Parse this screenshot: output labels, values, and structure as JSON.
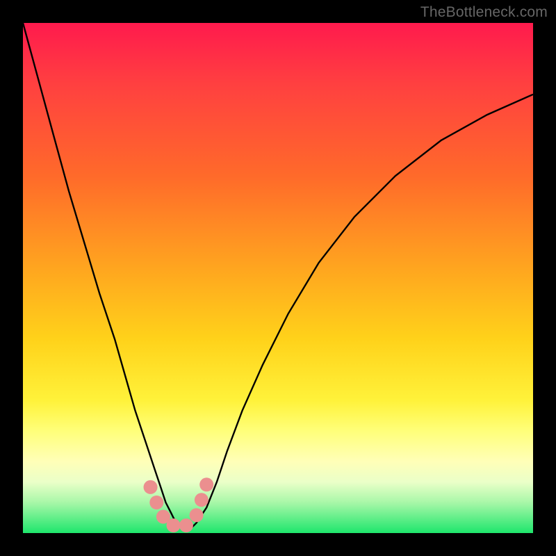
{
  "watermark": {
    "text": "TheBottleneck.com"
  },
  "chart_data": {
    "type": "line",
    "title": "",
    "xlabel": "",
    "ylabel": "",
    "xlim": [
      0,
      100
    ],
    "ylim": [
      0,
      100
    ],
    "grid": false,
    "series": [
      {
        "name": "bottleneck-curve",
        "x": [
          0,
          3,
          6,
          9,
          12,
          15,
          18,
          20,
          22,
          24,
          26,
          27,
          28,
          29,
          30,
          31,
          32,
          33,
          34,
          36,
          38,
          40,
          43,
          47,
          52,
          58,
          65,
          73,
          82,
          91,
          100
        ],
        "values": [
          100,
          89,
          78,
          67,
          57,
          47,
          38,
          31,
          24,
          18,
          12,
          9,
          6,
          4,
          2,
          1,
          1,
          1,
          2,
          5,
          10,
          16,
          24,
          33,
          43,
          53,
          62,
          70,
          77,
          82,
          86
        ]
      }
    ],
    "markers": [
      {
        "x": 25.0,
        "y": 9.0
      },
      {
        "x": 26.2,
        "y": 6.0
      },
      {
        "x": 27.5,
        "y": 3.2
      },
      {
        "x": 29.5,
        "y": 1.5
      },
      {
        "x": 32.0,
        "y": 1.5
      },
      {
        "x": 34.0,
        "y": 3.5
      },
      {
        "x": 35.0,
        "y": 6.5
      },
      {
        "x": 36.0,
        "y": 9.5
      }
    ],
    "marker_color": "#eb8f8f",
    "curve_color": "#000000"
  }
}
